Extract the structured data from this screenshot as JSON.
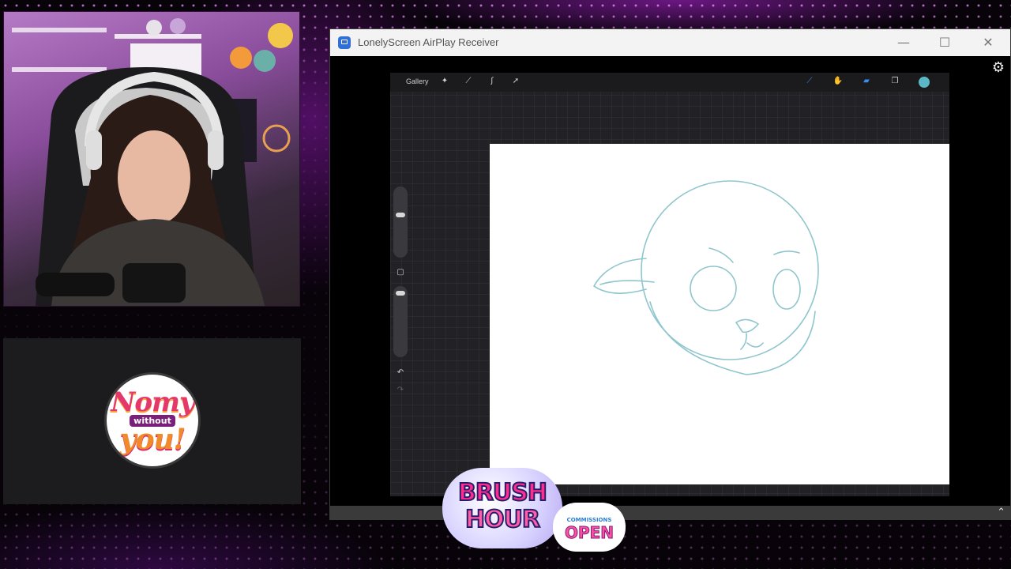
{
  "window": {
    "title": "LonelyScreen AirPlay Receiver",
    "icons": {
      "minimize": "minimize-icon",
      "maximize": "maximize-icon",
      "close": "close-icon",
      "settings": "gear-icon",
      "scroll": "chevron-up-icon"
    }
  },
  "procreate": {
    "gallery_label": "Gallery",
    "tools": [
      "wrench-icon",
      "magic-wand-icon",
      "selection-icon",
      "transform-icon"
    ],
    "right_tools": [
      "brush-icon",
      "smudge-icon",
      "eraser-icon",
      "layers-icon"
    ],
    "current_color": "#5ab8c6",
    "side_icons": {
      "modify": "square-icon",
      "undo": "undo-icon",
      "redo": "redo-icon"
    }
  },
  "overlay": {
    "logo": {
      "line1": "Nomy",
      "line2": "without",
      "line3": "you!"
    },
    "brush_hour": {
      "line1": "BRUSH",
      "line2": "HOUR"
    },
    "commissions": {
      "line1": "COMMISSIONS",
      "line2": "OPEN"
    }
  }
}
